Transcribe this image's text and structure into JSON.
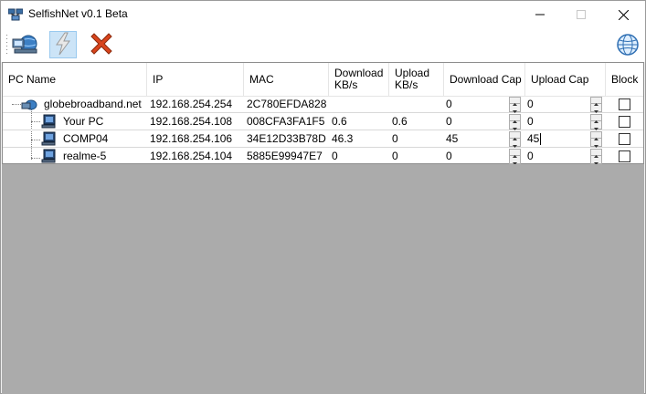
{
  "window": {
    "title": "SelfishNet v0.1 Beta",
    "icons": {
      "app": "network-app-icon",
      "minimize": "minimize-icon",
      "maximize": "maximize-icon",
      "close": "close-icon"
    }
  },
  "toolbar": {
    "items": [
      {
        "name": "network-scan-icon"
      },
      {
        "name": "lightning-start-icon",
        "selected": true
      },
      {
        "name": "red-x-stop-icon"
      }
    ],
    "right_icon": "globe-icon"
  },
  "grid": {
    "columns": [
      {
        "label": "PC Name"
      },
      {
        "label": "IP"
      },
      {
        "label": "MAC"
      },
      {
        "label": "Download\nKB/s"
      },
      {
        "label": "Upload\nKB/s"
      },
      {
        "label": "Download Cap"
      },
      {
        "label": "Upload Cap"
      },
      {
        "label": "Block"
      }
    ],
    "rows": [
      {
        "name": "globebroadband.net",
        "ip": "192.168.254.254",
        "mac": "2C780EFDA828",
        "down": "",
        "up": "",
        "down_cap": "0",
        "up_cap": "0",
        "block": false,
        "level": 0
      },
      {
        "name": "Your PC",
        "ip": "192.168.254.108",
        "mac": "008CFA3FA1F5",
        "down": "0.6",
        "up": "0.6",
        "down_cap": "0",
        "up_cap": "0",
        "block": false,
        "level": 1
      },
      {
        "name": "COMP04",
        "ip": "192.168.254.106",
        "mac": "34E12D33B78D",
        "down": "46.3",
        "up": "0",
        "down_cap": "45",
        "up_cap": "45",
        "block": false,
        "level": 1,
        "editing": true
      },
      {
        "name": "realme-5",
        "ip": "192.168.254.104",
        "mac": "5885E99947E7",
        "down": "0",
        "up": "0",
        "down_cap": "0",
        "up_cap": "0",
        "block": false,
        "level": 1
      }
    ]
  },
  "colors": {
    "empty_area": "#ababab",
    "selected_tool": "#cce4f7",
    "accent_red": "#d9441c"
  }
}
